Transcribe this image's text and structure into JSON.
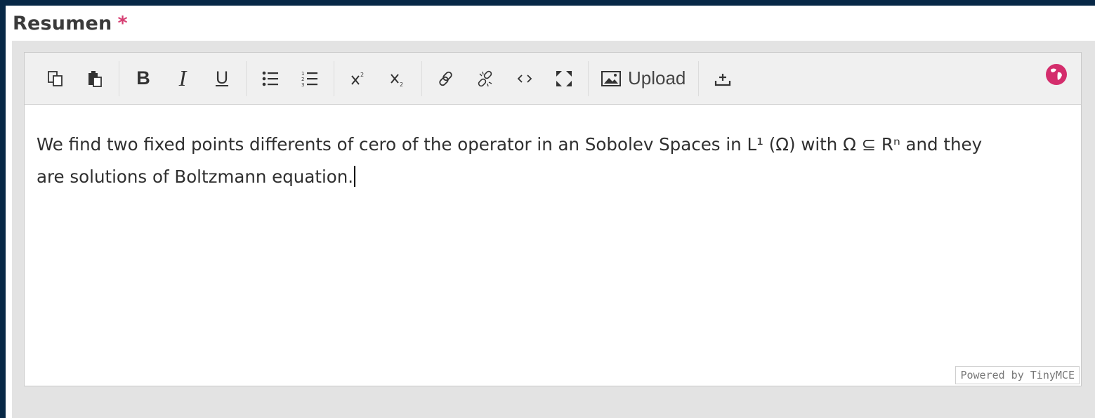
{
  "field": {
    "label": "Resumen",
    "required_marker": "*"
  },
  "toolbar": {
    "upload_label": "Upload"
  },
  "editor": {
    "content_line1": "We find two fixed points differents of cero of the operator in an Sobolev Spaces in L¹ (Ω) with Ω ⊆ Rⁿ and they",
    "content_line2": "are solutions of Boltzmann equation.",
    "powered_by": "Powered by TinyMCE"
  },
  "icons": [
    "copy-icon",
    "paste-icon",
    "bold-icon",
    "italic-icon",
    "underline-icon",
    "bullet-list-icon",
    "numbered-list-icon",
    "superscript-icon",
    "subscript-icon",
    "link-icon",
    "unlink-icon",
    "code-icon",
    "fullscreen-icon",
    "image-icon",
    "insert-icon",
    "globe-icon"
  ],
  "colors": {
    "page_bg": "#072846",
    "required": "#d63e72",
    "globe": "#d42d6c"
  }
}
